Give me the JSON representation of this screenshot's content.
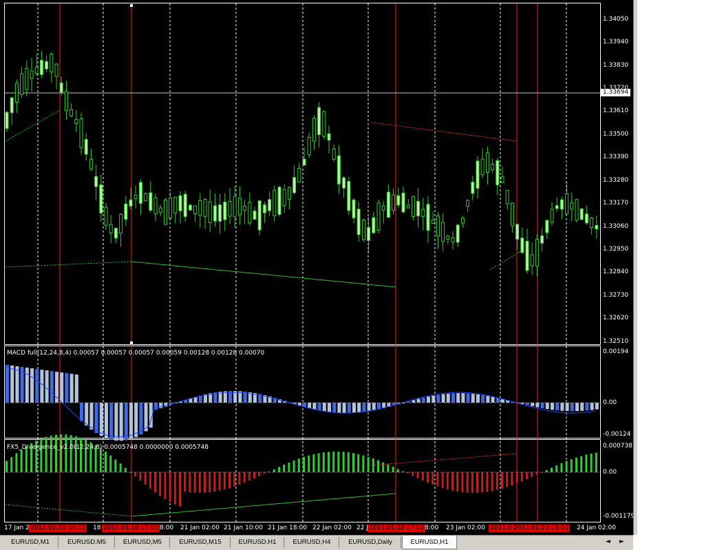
{
  "chart": {
    "price_axis": [
      "1.34050",
      "1.33940",
      "1.33830",
      "1.33720",
      "1.33610",
      "1.33500",
      "1.33390",
      "1.33280",
      "1.33170",
      "1.33060",
      "1.32950",
      "1.32840",
      "1.32730",
      "1.32620",
      "1.32510"
    ],
    "current_price": "1.33694",
    "colors": {
      "bull": "#b8f7a0",
      "bear": "#000000",
      "wick": "#32cd32",
      "vline": "#ff2020",
      "grid": "#ffffff"
    }
  },
  "macd": {
    "title": "MACD full(12,24,8,4) 0.00057 0.00057 0.00057 0.00059 0.00128 0.00128 0.00070",
    "axis": [
      "0.00194",
      "0.00",
      "-0.00124"
    ]
  },
  "divergence": {
    "title": "FX5_Divergence_v2.0(12,24,8) 0.0005748 0.0000000 0.0005748",
    "axis": [
      "0.000738",
      "0.00",
      "-0.001179"
    ]
  },
  "time_axis": [
    {
      "label": "17 Jan 20"
    },
    {
      "label": "18 J"
    },
    {
      "label": "8:00"
    },
    {
      "label": "21 Jan 02:00"
    },
    {
      "label": "21 Jan 10:00"
    },
    {
      "label": "21 Jan 18:00"
    },
    {
      "label": "22 Jan 02:00"
    },
    {
      "label": "22 J"
    },
    {
      "label": "8:00"
    },
    {
      "label": "23 Jan 02:00"
    },
    {
      "label": "24 Jan 02:00"
    }
  ],
  "vline_labels": [
    "2013.01.18 04:00",
    "2013.01.18 17:00",
    "2013.01.22 17:00",
    "2013.0",
    "2013.01.23 19:00"
  ],
  "tabs": [
    "EURUSD,M1",
    "EURUSD,M5",
    "EURUSD,M5",
    "EURUSD,M15",
    "EURUSD,H1",
    "EURUSD,H4",
    "EURUSD,Daily",
    "EURUSD,H1"
  ],
  "active_tab_index": 7,
  "tab_scroll": {
    "left": "◄",
    "right": "►"
  }
}
